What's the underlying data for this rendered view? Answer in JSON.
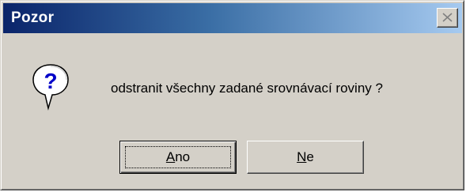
{
  "dialog": {
    "title": "Pozor",
    "message": "odstranit všechny zadané srovnávací roviny ?",
    "icon": "question-icon",
    "buttons": {
      "yes": {
        "mnemonic": "A",
        "rest": "no"
      },
      "no": {
        "mnemonic": "N",
        "rest": "e"
      }
    }
  },
  "colors": {
    "title_gradient_start": "#0a246a",
    "title_gradient_end": "#a6caf0",
    "face": "#d4d0c8"
  }
}
